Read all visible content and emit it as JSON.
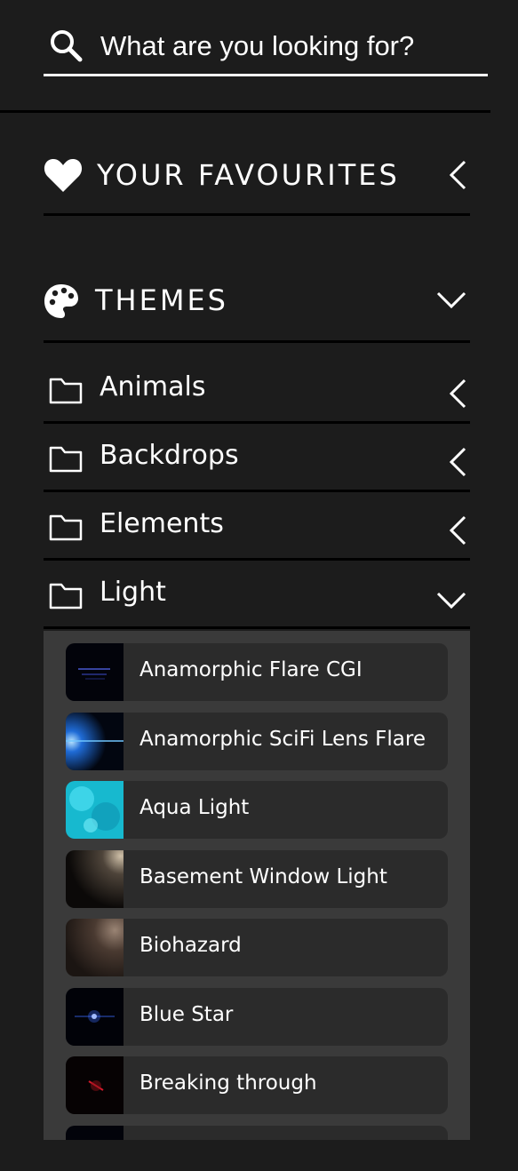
{
  "search": {
    "placeholder": "What are you looking for?",
    "icon": "search-icon"
  },
  "favourites": {
    "title": "YOUR FAVOURITES",
    "icon": "heart-icon",
    "state": "collapsed"
  },
  "themes": {
    "title": "THEMES",
    "icon": "palette-icon",
    "state": "expanded"
  },
  "folders": [
    {
      "label": "Animals",
      "state": "collapsed"
    },
    {
      "label": "Backdrops",
      "state": "collapsed"
    },
    {
      "label": "Elements",
      "state": "collapsed"
    },
    {
      "label": "Light",
      "state": "expanded"
    }
  ],
  "light_items": [
    {
      "label": "Anamorphic Flare CGI"
    },
    {
      "label": "Anamorphic SciFi Lens Flare"
    },
    {
      "label": "Aqua Light"
    },
    {
      "label": "Basement Window Light"
    },
    {
      "label": "Biohazard"
    },
    {
      "label": "Blue Star"
    },
    {
      "label": "Breaking through"
    },
    {
      "label": ""
    }
  ],
  "colors": {
    "background": "#1c1c1c",
    "panel": "#3a3a3a",
    "item": "#2b2b2b",
    "text": "#ffffff"
  }
}
